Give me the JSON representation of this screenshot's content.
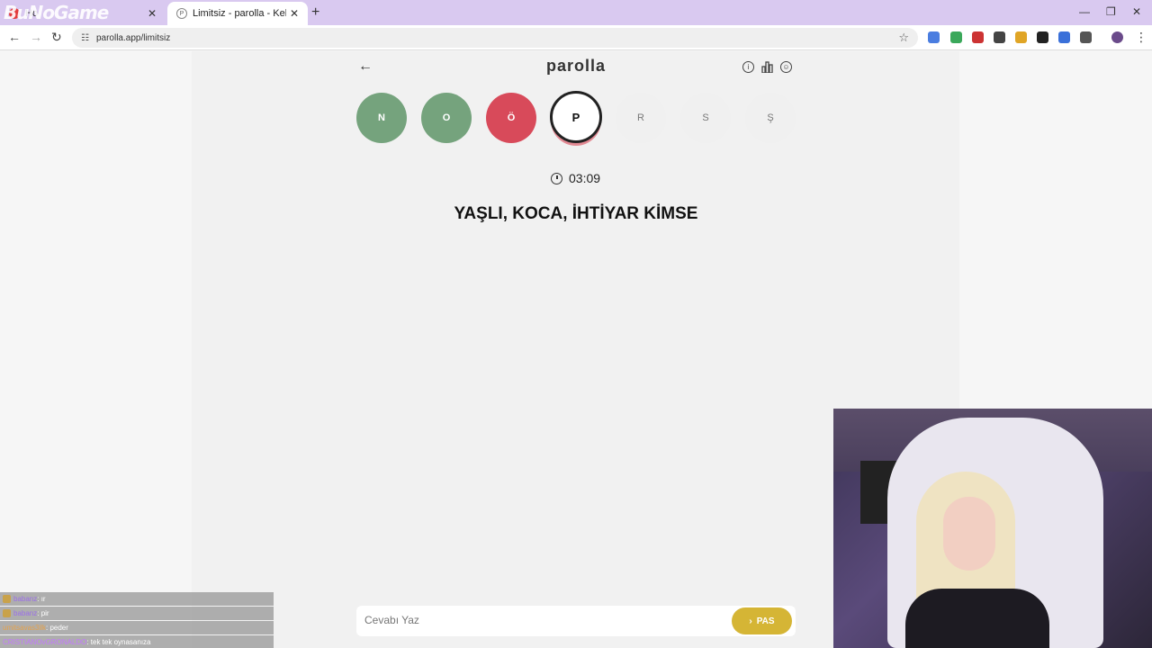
{
  "browser": {
    "tabs": [
      {
        "title": "Ho",
        "active": false
      },
      {
        "title": "Limitsiz - parolla - Kelime oyunu",
        "active": true
      }
    ],
    "overlay_brand": "BuNoGame",
    "url": "parolla.app/limitsiz"
  },
  "app": {
    "logo": "parolla",
    "letters": [
      {
        "letter": "N",
        "state": "correct"
      },
      {
        "letter": "O",
        "state": "correct"
      },
      {
        "letter": "Ö",
        "state": "wrong"
      },
      {
        "letter": "P",
        "state": "current"
      },
      {
        "letter": "R",
        "state": "pending"
      },
      {
        "letter": "S",
        "state": "pending"
      },
      {
        "letter": "Ş",
        "state": "pending"
      }
    ],
    "timer": "03:09",
    "question": "YAŞLI, KOCA, İHTİYAR KİMSE",
    "answer_placeholder": "Cevabı Yaz",
    "pass_label": "PAS",
    "colors": {
      "correct": "#75a37d",
      "wrong": "#d84a5a",
      "pass": "#d5b535"
    }
  },
  "chat": [
    {
      "user": "babanz",
      "message": ": ır"
    },
    {
      "user": "babanz",
      "message": ": pir"
    },
    {
      "user": "umitsavas3ilk",
      "message": ": peder"
    },
    {
      "user": "CRISTIANOvGRONALDO",
      "message": ": tek tek oynasanıza"
    }
  ]
}
